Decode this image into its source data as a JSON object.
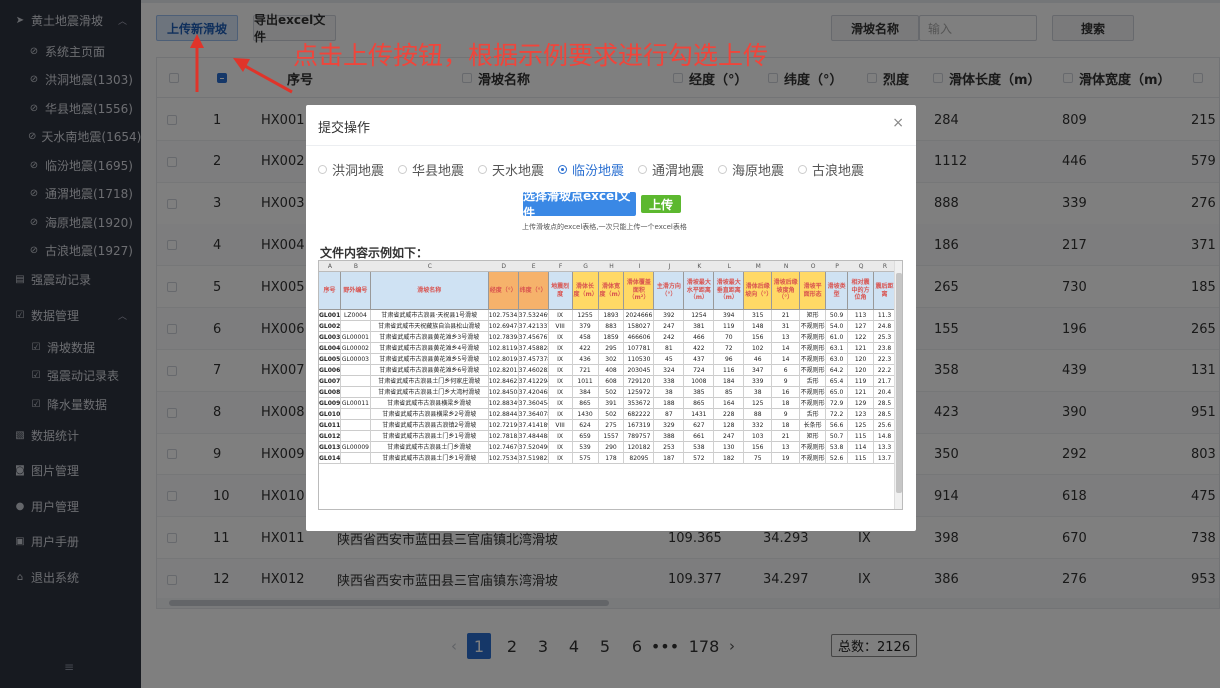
{
  "sidebar": {
    "group_loess": "黄土地震滑坡",
    "items": [
      "系统主页面",
      "洪洞地震(1303)",
      "华县地震(1556)",
      "天水南地震(1654)",
      "临汾地震(1695)",
      "通渭地震(1718)",
      "海原地震(1920)",
      "古浪地震(1927)"
    ],
    "strong_quake_record": "强震动记录",
    "data_mgmt": "数据管理",
    "data_items": [
      "滑坡数据",
      "强震动记录表",
      "降水量数据"
    ],
    "data_stats": "数据统计",
    "image_mgmt": "图片管理",
    "user_mgmt": "用户管理",
    "user_manual": "用户手册",
    "logout": "退出系统",
    "collapse_glyph": "≡"
  },
  "toolbar": {
    "upload_btn": "上传新滑坡",
    "export_btn": "导出excel文件",
    "search_label": "滑坡名称",
    "search_placeholder": "输入",
    "search_btn": "搜索"
  },
  "callout_text": "点击上传按钮，根据示例要求进行勾选上传",
  "table": {
    "headers": [
      "序号",
      "滑坡名称",
      "经度（°）",
      "纬度（°）",
      "烈度",
      "滑体长度（m）",
      "滑体宽度（m）"
    ],
    "rows": [
      {
        "no": "1",
        "id": "HX001",
        "name": "",
        "lon": "",
        "lat": "",
        "intensity": "",
        "len": "284",
        "wid": "809",
        "extra": "215"
      },
      {
        "no": "2",
        "id": "HX002",
        "name": "",
        "lon": "",
        "lat": "",
        "intensity": "",
        "len": "1112",
        "wid": "446",
        "extra": "579"
      },
      {
        "no": "3",
        "id": "HX003",
        "name": "",
        "lon": "",
        "lat": "",
        "intensity": "",
        "len": "888",
        "wid": "339",
        "extra": "276"
      },
      {
        "no": "4",
        "id": "HX004",
        "name": "",
        "lon": "",
        "lat": "",
        "intensity": "",
        "len": "186",
        "wid": "217",
        "extra": "371"
      },
      {
        "no": "5",
        "id": "HX005",
        "name": "",
        "lon": "",
        "lat": "",
        "intensity": "",
        "len": "265",
        "wid": "730",
        "extra": "185"
      },
      {
        "no": "6",
        "id": "HX006",
        "name": "",
        "lon": "",
        "lat": "",
        "intensity": "",
        "len": "155",
        "wid": "196",
        "extra": "265"
      },
      {
        "no": "7",
        "id": "HX007",
        "name": "",
        "lon": "",
        "lat": "",
        "intensity": "",
        "len": "358",
        "wid": "439",
        "extra": "131"
      },
      {
        "no": "8",
        "id": "HX008",
        "name": "",
        "lon": "",
        "lat": "",
        "intensity": "",
        "len": "423",
        "wid": "390",
        "extra": "951"
      },
      {
        "no": "9",
        "id": "HX009",
        "name": "",
        "lon": "",
        "lat": "",
        "intensity": "",
        "len": "350",
        "wid": "292",
        "extra": "803"
      },
      {
        "no": "10",
        "id": "HX010",
        "name": "",
        "lon": "",
        "lat": "",
        "intensity": "",
        "len": "914",
        "wid": "618",
        "extra": "475"
      },
      {
        "no": "11",
        "id": "HX011",
        "name": "陕西省西安市蓝田县三官庙镇北湾滑坡",
        "lon": "109.365",
        "lat": "34.293",
        "intensity": "IX",
        "len": "398",
        "wid": "670",
        "extra": "738"
      },
      {
        "no": "12",
        "id": "HX012",
        "name": "陕西省西安市蓝田县三官庙镇东湾滑坡",
        "lon": "109.377",
        "lat": "34.297",
        "intensity": "IX",
        "len": "386",
        "wid": "276",
        "extra": "953"
      }
    ]
  },
  "pagination": {
    "prev": "‹",
    "next": "›",
    "pages": [
      "1",
      "2",
      "3",
      "4",
      "5",
      "6",
      "•••",
      "178"
    ],
    "active": "1",
    "total": "总数：2126"
  },
  "modal": {
    "title": "提交操作",
    "close": "×",
    "radios": [
      "洪洞地震",
      "华县地震",
      "天水地震",
      "临汾地震",
      "通渭地震",
      "海原地震",
      "古浪地震"
    ],
    "selected": "临汾地震",
    "select_btn": "选择滑坡点excel文件",
    "upload_btn": "上传",
    "hint": "上传滑坡点的excel表格,一次只能上传一个excel表格",
    "example_title": "文件内容示例如下："
  },
  "sheet": {
    "col_letters": [
      "A",
      "B",
      "C",
      "D",
      "E",
      "F",
      "G",
      "H",
      "I",
      "J",
      "K",
      "L",
      "M",
      "N",
      "O",
      "P",
      "Q",
      "R"
    ],
    "headers": [
      "序号",
      "野外编号",
      "滑坡名称",
      "经度（°）",
      "纬度（°）",
      "地震烈度",
      "滑体长度（m）",
      "滑体宽度（m）",
      "滑体覆盖面积（m²）",
      "主滑方向（°）",
      "滑坡最大水平距离（m）",
      "滑坡最大垂直距离（m）",
      "滑体后缘坡向（°）",
      "滑坡后缘坡度角（°）",
      "滑坡平面形态",
      "滑坡类型",
      "相对震中的方位角",
      "震后距离"
    ],
    "header_colors": [
      "#d9534f",
      "#d9534f",
      "#d9534f",
      "#d9534f",
      "#d9534f",
      "#d9534f",
      "#d9534f",
      "#d9534f",
      "#d9534f",
      "#d9534f",
      "#d9534f",
      "#d9534f",
      "#d9534f",
      "#d9534f",
      "#d9534f",
      "#d9534f",
      "#d9534f",
      "#d9534f"
    ],
    "header_bg": [
      "#cfe2f3",
      "#cfe2f3",
      "#cfe2f3",
      "#f6b26b",
      "#f6b26b",
      "#cfe2f3",
      "#ffd966",
      "#ffd966",
      "#ffd966",
      "#cfe2f3",
      "#cfe2f3",
      "#cfe2f3",
      "#ffd966",
      "#ffd966",
      "#ffd966",
      "#cfe2f3",
      "#cfe2f3",
      "#cfe2f3"
    ],
    "rows": [
      [
        "GL001",
        "LZ0004",
        "甘肃省武威市古浪县·天祝县1号滑坡",
        "102.753454",
        "37.532469",
        "IX",
        "1255",
        "1893",
        "2024666",
        "392",
        "1254",
        "394",
        "315",
        "21",
        "矩形",
        "50.9",
        "113",
        "11.3"
      ],
      [
        "GL002",
        "",
        "甘肃省武威市天祝藏族自治县松山滑坡",
        "102.694748",
        "37.421337",
        "VIII",
        "379",
        "883",
        "158027",
        "247",
        "381",
        "119",
        "148",
        "31",
        "不规则形",
        "54.0",
        "127",
        "24.8"
      ],
      [
        "GL003",
        "GL00001",
        "甘肃省武威市古浪县黄花滩乡3号滑坡",
        "102.783944",
        "37.456767",
        "IX",
        "458",
        "1859",
        "466606",
        "242",
        "466",
        "70",
        "156",
        "13",
        "不规则形",
        "61.0",
        "122",
        "25.3"
      ],
      [
        "GL004",
        "GL00002",
        "甘肃省武威市古浪县黄花滩乡4号滑坡",
        "102.811944",
        "37.458828",
        "IX",
        "422",
        "295",
        "107781",
        "81",
        "422",
        "72",
        "102",
        "14",
        "不规则形",
        "63.1",
        "121",
        "23.8"
      ],
      [
        "GL005",
        "GL00003",
        "甘肃省武威市古浪县黄花滩乡5号滑坡",
        "102.801942",
        "37.457378",
        "IX",
        "436",
        "302",
        "110530",
        "45",
        "437",
        "96",
        "46",
        "14",
        "不规则形",
        "63.0",
        "120",
        "22.3"
      ],
      [
        "GL006",
        "",
        "甘肃省武威市古浪县黄花滩乡6号滑坡",
        "102.820157",
        "37.460282",
        "IX",
        "721",
        "408",
        "203045",
        "324",
        "724",
        "116",
        "347",
        "6",
        "不规则形",
        "64.2",
        "120",
        "22.2"
      ],
      [
        "GL007",
        "",
        "甘肃省武威市古浪县土门乡何家庄滑坡",
        "102.846239",
        "37.412294",
        "IX",
        "1011",
        "608",
        "729120",
        "338",
        "1008",
        "184",
        "339",
        "9",
        "舌形",
        "65.4",
        "119",
        "21.7"
      ],
      [
        "GL008",
        "",
        "甘肃省武威市古浪县土门乡大湾村滑坡",
        "102.845086",
        "37.420468",
        "IX",
        "384",
        "502",
        "125972",
        "38",
        "385",
        "85",
        "38",
        "16",
        "不规则形",
        "65.0",
        "121",
        "20.4"
      ],
      [
        "GL009",
        "GL00011",
        "甘肃省武威市古浪县横梁乡滑坡",
        "102.883491",
        "37.360454",
        "IX",
        "865",
        "391",
        "353672",
        "188",
        "865",
        "164",
        "125",
        "18",
        "不规则形",
        "72.9",
        "129",
        "28.5"
      ],
      [
        "GL010",
        "",
        "甘肃省武威市古浪县横梁乡2号滑坡",
        "102.884432",
        "37.364078",
        "IX",
        "1430",
        "502",
        "682222",
        "87",
        "1431",
        "228",
        "88",
        "9",
        "舌形",
        "72.2",
        "123",
        "28.5"
      ],
      [
        "GL011",
        "",
        "甘肃省武威市古浪县古浪镇2号滑坡",
        "102.721967",
        "37.414189",
        "VIII",
        "624",
        "275",
        "167319",
        "329",
        "627",
        "128",
        "332",
        "18",
        "长条形",
        "56.6",
        "125",
        "25.6"
      ],
      [
        "GL012",
        "",
        "甘肃省武威市古浪县土门乡1号滑坡",
        "102.781835",
        "37.484488",
        "IX",
        "659",
        "1557",
        "789757",
        "388",
        "661",
        "247",
        "103",
        "21",
        "矩形",
        "50.7",
        "115",
        "14.8"
      ],
      [
        "GL013",
        "GL00009",
        "甘肃省武威市古浪县土门乡滑坡",
        "102.746700",
        "37.520490",
        "IX",
        "539",
        "290",
        "120182",
        "253",
        "538",
        "130",
        "156",
        "13",
        "不规则形",
        "53.8",
        "114",
        "13.3"
      ],
      [
        "GL014",
        "",
        "甘肃省武威市古浪县土门乡1号滑坡",
        "102.753424",
        "37.519823",
        "IX",
        "575",
        "178",
        "82095",
        "187",
        "572",
        "182",
        "75",
        "19",
        "不规则形",
        "52.6",
        "115",
        "13.7"
      ]
    ]
  }
}
